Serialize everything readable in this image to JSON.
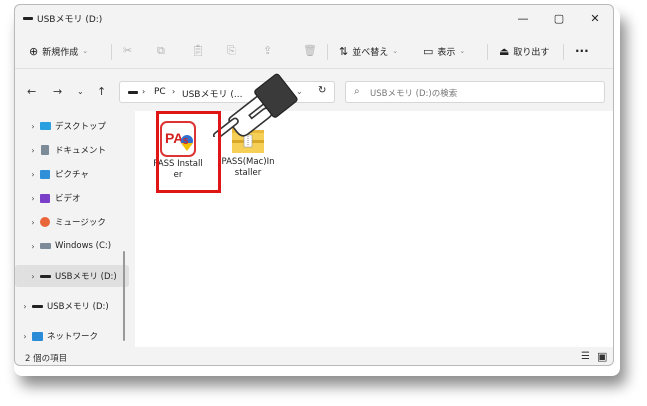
{
  "window": {
    "title": "USBメモリ (D:)",
    "controls": [
      "—",
      "▢",
      "✕"
    ]
  },
  "commandbar": {
    "new_label": "新規作成",
    "sort_label": "並べ替え",
    "view_label": "表示",
    "eject_label": "取り出す",
    "more_label": "···"
  },
  "address": {
    "crumb_pc": "PC",
    "crumb_drive": "USBメモリ (...",
    "search_placeholder": "USBメモリ (D:)の検索"
  },
  "nav": {
    "items": [
      {
        "label": "デスクトップ",
        "icon": "desktop-icon",
        "color": "#2aa0e0"
      },
      {
        "label": "ドキュメント",
        "icon": "documents-icon",
        "color": "#6b7b8c"
      },
      {
        "label": "ピクチャ",
        "icon": "pictures-icon",
        "color": "#2f8fd8"
      },
      {
        "label": "ビデオ",
        "icon": "videos-icon",
        "color": "#7a3fc9"
      },
      {
        "label": "ミュージック",
        "icon": "music-icon",
        "color": "#e8663a"
      },
      {
        "label": "Windows (C:)",
        "icon": "windows-drive-icon",
        "color": "#6b7b8c"
      },
      {
        "label": "USBメモリ (D:)",
        "icon": "usb-drive-icon",
        "color": "#222222"
      },
      {
        "label": "USBメモリ (D:)",
        "icon": "usb-drive-icon",
        "color": "#222222"
      },
      {
        "label": "ネットワーク",
        "icon": "network-icon",
        "color": "#2a8bd6"
      }
    ]
  },
  "files": [
    {
      "label": "PASS Installer",
      "icon": "pass-app-icon"
    },
    {
      "label": "PASS(Mac)Installer",
      "icon": "zip-folder-icon"
    }
  ],
  "status": {
    "count": "2 個の項目"
  },
  "colors": {
    "highlight": "#e01515",
    "selected_nav": "#e0e0e0"
  }
}
